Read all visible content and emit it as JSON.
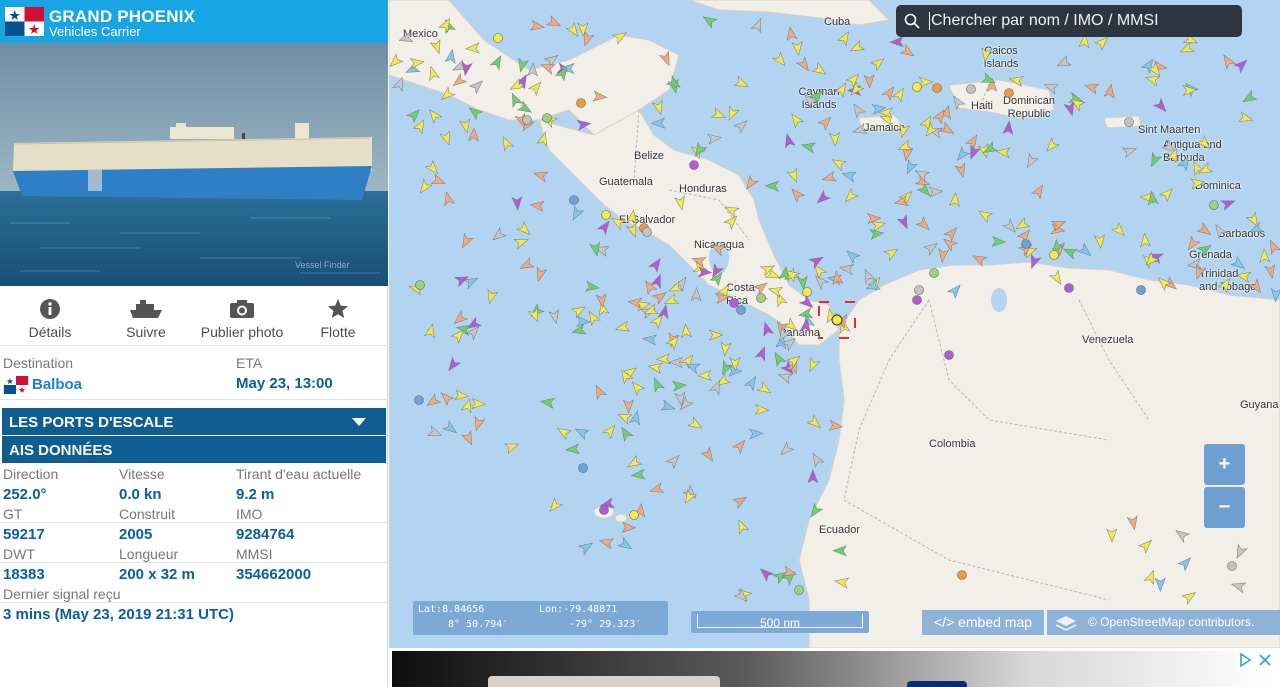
{
  "vessel": {
    "name": "GRAND PHOENIX",
    "type": "Vehicles Carrier",
    "flag_icon": "panama-flag-icon",
    "photo_credit": "Vessel Finder"
  },
  "actions": [
    {
      "label": "Détails",
      "icon": "info-icon"
    },
    {
      "label": "Suivre",
      "icon": "ship-icon"
    },
    {
      "label": "Publier photo",
      "icon": "camera-icon"
    },
    {
      "label": "Flotte",
      "icon": "star-icon"
    }
  ],
  "voyage": {
    "destination_label": "Destination",
    "destination_value": "Balboa",
    "eta_label": "ETA",
    "eta_value": "May 23, 13:00"
  },
  "sections": {
    "ports": "LES PORTS D'ESCALE",
    "ais": "AIS DONNÉES"
  },
  "ais": {
    "course_label": "Direction",
    "course_value": "252.0°",
    "speed_label": "Vitesse",
    "speed_value": "0.0 kn",
    "draught_label": "Tirant d'eau actuelle",
    "draught_value": "9.2 m",
    "gt_label": "GT",
    "gt_value": "59217",
    "built_label": "Construit",
    "built_value": "2005",
    "imo_label": "IMO",
    "imo_value": "9284764",
    "dwt_label": "DWT",
    "dwt_value": "18383",
    "length_label": "Longueur",
    "length_value": "200 x 32 m",
    "mmsi_label": "MMSI",
    "mmsi_value": "354662000",
    "last_signal_label": "Dernier signal reçu",
    "last_signal_value": "3 mins (May 23, 2019 21:31 UTC)"
  },
  "map": {
    "search_placeholder": "Chercher par nom / IMO / MMSI",
    "lat_label": "Lat:8.84656",
    "lon_label": "Lon:-79.48871",
    "lat_dms": "8° 50.794′",
    "lon_dms": "-79° 29.323′",
    "scale": "500 nm",
    "embed": "</> embed map",
    "attribution": "© OpenStreetMap contributors.",
    "zoom_in": "+",
    "zoom_out": "−",
    "places": [
      {
        "name": "Mexico"
      },
      {
        "name": "Cuba"
      },
      {
        "name": "Caicos Islands"
      },
      {
        "name": "Cayman Islands"
      },
      {
        "name": "Haiti"
      },
      {
        "name": "Dominican Republic"
      },
      {
        "name": "Jamaica"
      },
      {
        "name": "Belize"
      },
      {
        "name": "Guatemala"
      },
      {
        "name": "Honduras"
      },
      {
        "name": "El Salvador"
      },
      {
        "name": "Nicaragua"
      },
      {
        "name": "Costa Rica"
      },
      {
        "name": "Panama"
      },
      {
        "name": "Venezuela"
      },
      {
        "name": "Colombia"
      },
      {
        "name": "Ecuador"
      },
      {
        "name": "Guyana"
      },
      {
        "name": "Sint Maarten"
      },
      {
        "name": "Antigua and Barbuda"
      },
      {
        "name": "Dominica"
      },
      {
        "name": "Barbados"
      },
      {
        "name": "Grenada"
      },
      {
        "name": "Trinidad and Tobago"
      }
    ]
  },
  "colors": {
    "header": "#17a6e3",
    "section_bar": "#0f5e92",
    "value_text": "#0b5ea1",
    "sea": "#b3d4f1",
    "land": "#f2efe9"
  }
}
